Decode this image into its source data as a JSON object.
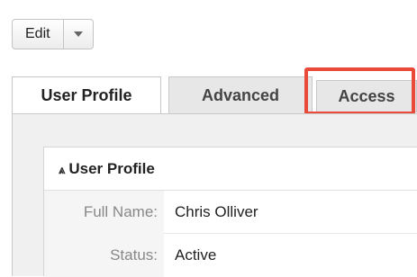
{
  "toolbar": {
    "edit_label": "Edit",
    "dropdown_icon": "caret-down-icon"
  },
  "tabs": [
    {
      "label": "User Profile",
      "active": true
    },
    {
      "label": "Advanced",
      "active": false
    },
    {
      "label": "Access",
      "active": false,
      "highlighted": true
    }
  ],
  "section": {
    "title": "User Profile",
    "collapse_icon": "double-chevron-up-icon",
    "fields": [
      {
        "label": "Full Name:",
        "value": "Chris Olliver"
      },
      {
        "label": "Status:",
        "value": "Active"
      }
    ]
  },
  "colors": {
    "highlight": "#e94a39",
    "tab_inactive": "#e7e7e7",
    "panel_bg": "#f0f0f0"
  }
}
